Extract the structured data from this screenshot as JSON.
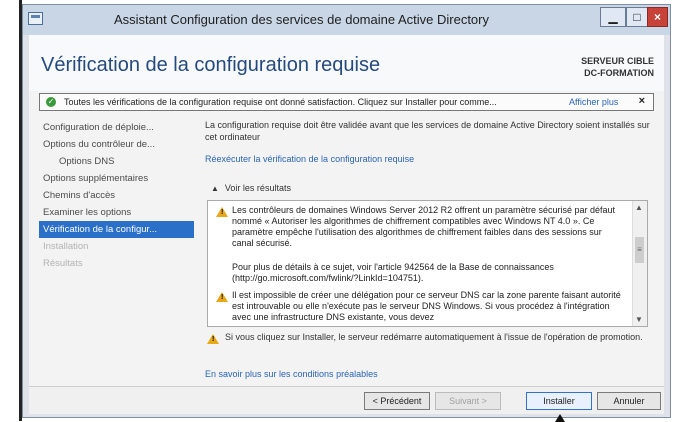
{
  "window": {
    "title": "Assistant Configuration des services de domaine Active Directory"
  },
  "header": {
    "title": "Vérification de la configuration requise",
    "server_label": "SERVEUR CIBLE",
    "server_name": "DC-FORMATION"
  },
  "notice": {
    "text": "Toutes les vérifications de la configuration requise ont donné satisfaction. Cliquez sur Installer pour comme...",
    "link": "Afficher plus",
    "close": "×"
  },
  "nav": {
    "items": [
      {
        "label": "Configuration de déploie..."
      },
      {
        "label": "Options du contrôleur de..."
      },
      {
        "label": "Options DNS"
      },
      {
        "label": "Options supplémentaires"
      },
      {
        "label": "Chemins d'accès"
      },
      {
        "label": "Examiner les options"
      },
      {
        "label": "Vérification de la configur..."
      },
      {
        "label": "Installation"
      },
      {
        "label": "Résultats"
      }
    ]
  },
  "content": {
    "intro": "La configuration requise doit être validée avant que les services de domaine Active Directory soient installés sur cet ordinateur",
    "rerun_link": "Réexécuter la vérification de la configuration requise",
    "results_header": "Voir les résultats",
    "messages": [
      "Les contrôleurs de domaines Windows Server 2012 R2 offrent un paramètre sécurisé par défaut nommé « Autoriser les algorithmes de chiffrement compatibles avec Windows NT 4.0 ». Ce paramètre empêche l'utilisation des algorithmes de chiffrement faibles dans des sessions sur canal sécurisé.",
      "Pour plus de détails à ce sujet, voir l'article 942564 de la Base de connaissances (http://go.microsoft.com/fwlink/?LinkId=104751).",
      "Il est impossible de créer une délégation pour ce serveur DNS car la zone parente faisant autorité est introuvable ou elle n'exécute pas le serveur DNS Windows. Si vous procédez à l'intégration avec une infrastructure DNS existante, vous devez"
    ],
    "restart_warning": "Si vous cliquez sur Installer, le serveur redémarre automatiquement à l'issue de l'opération de promotion.",
    "learn_more": "En savoir plus sur les conditions préalables"
  },
  "footer": {
    "previous": "< Précédent",
    "next": "Suivant >",
    "install": "Installer",
    "cancel": "Annuler"
  }
}
